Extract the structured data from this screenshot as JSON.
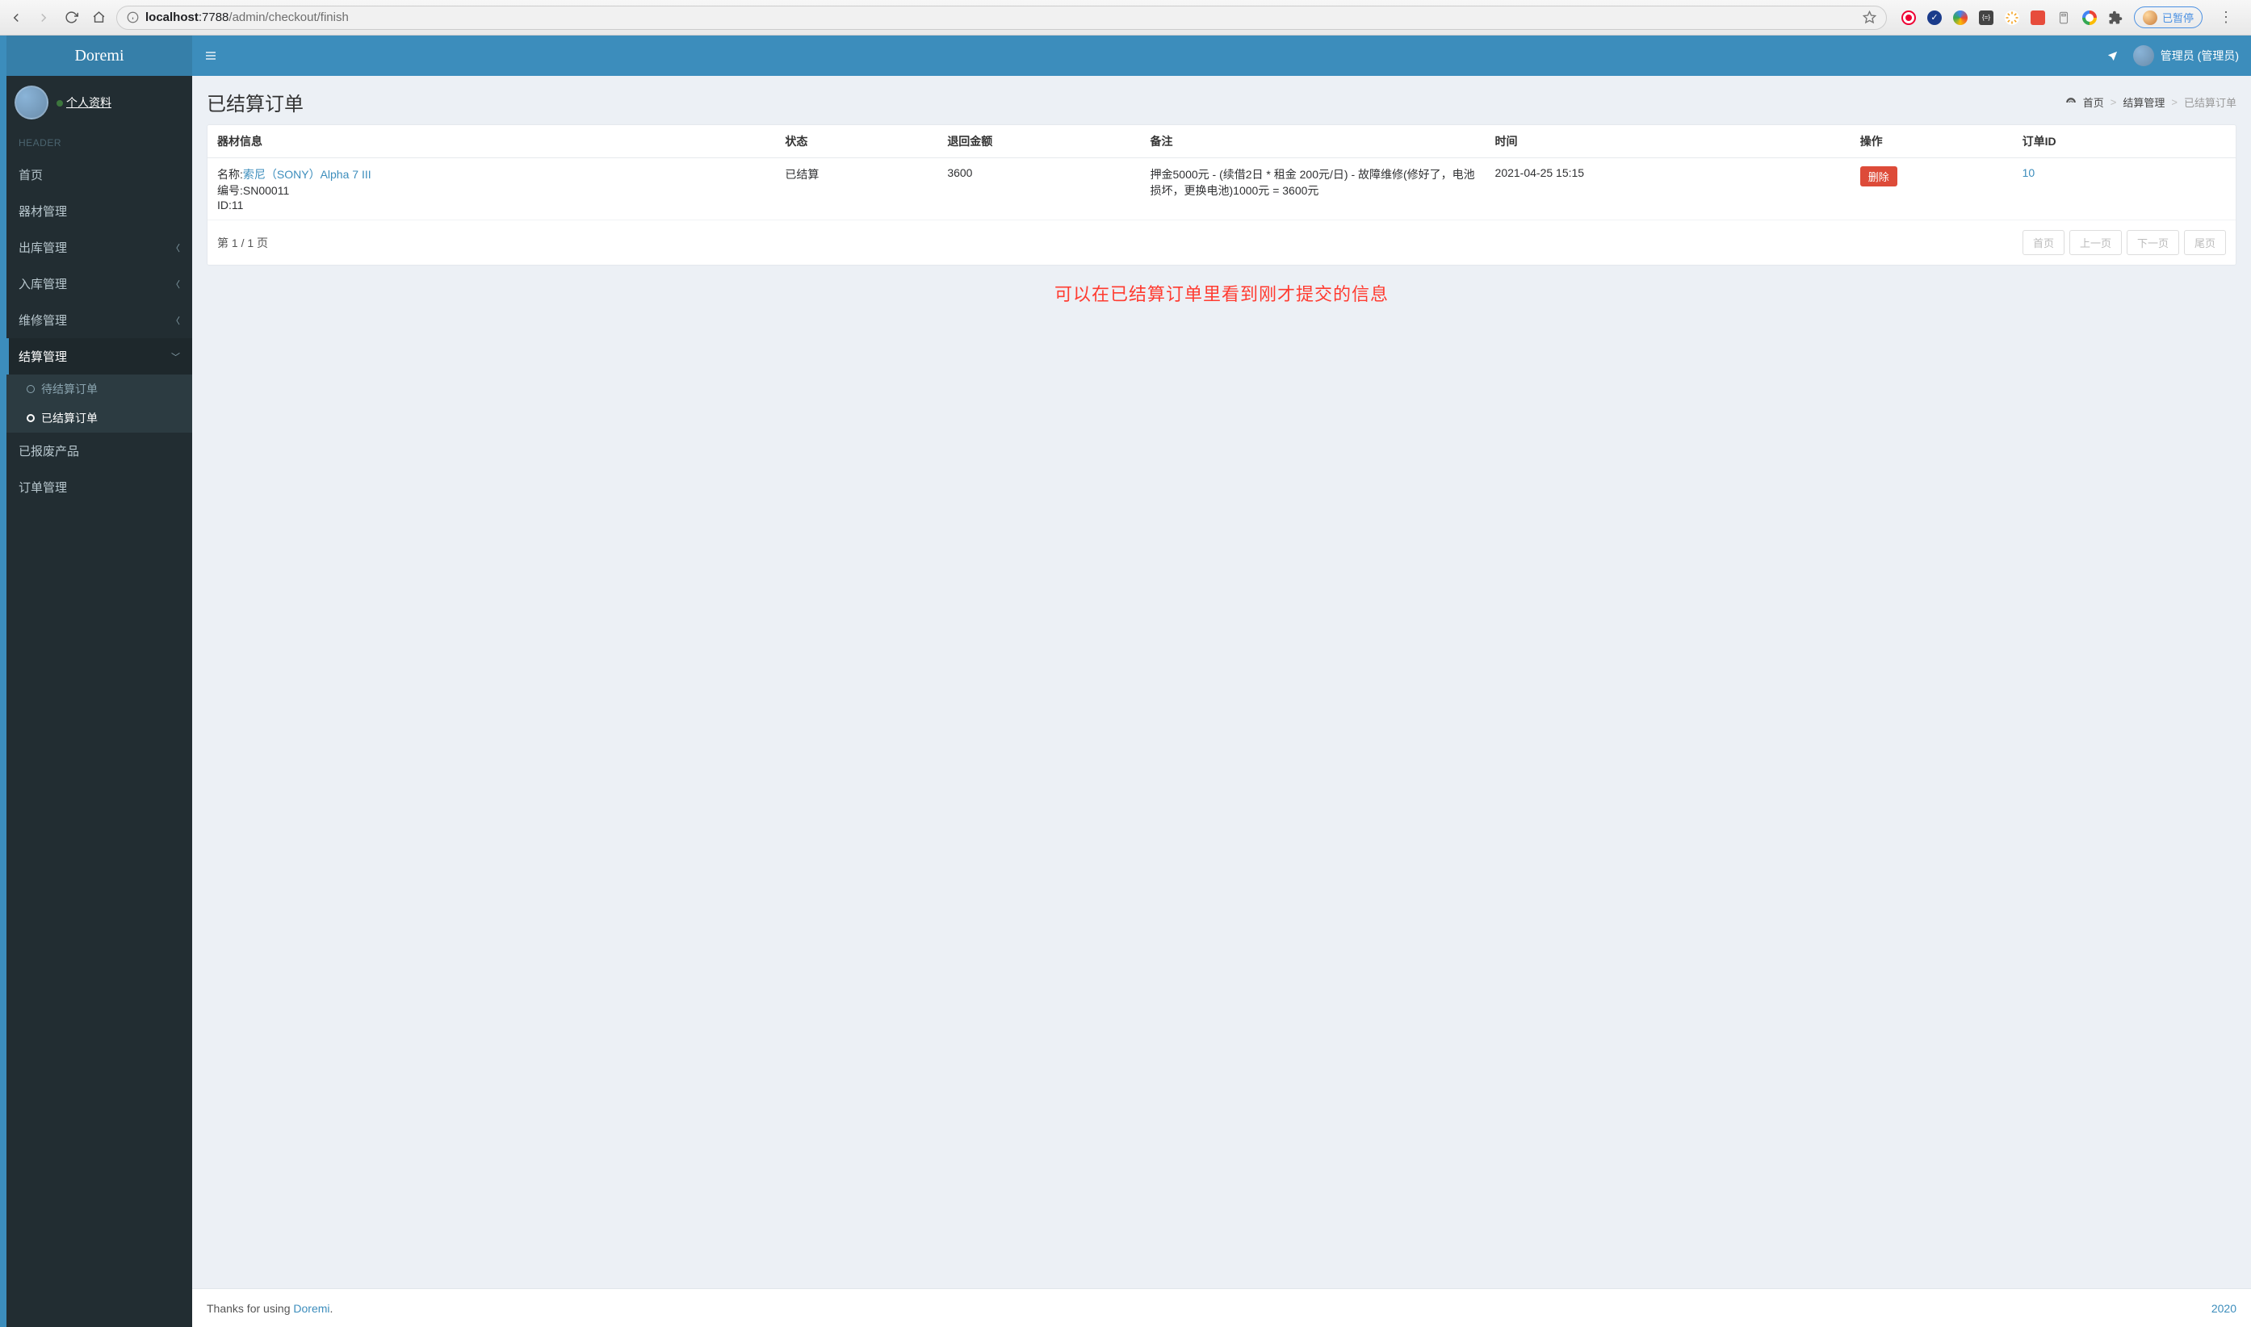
{
  "browser": {
    "url_host": "localhost",
    "url_port": ":7788",
    "url_path": "/admin/checkout/finish",
    "paused_label": "已暂停"
  },
  "brand": "Doremi",
  "user_panel": {
    "profile": "个人资料"
  },
  "sidebar": {
    "header": "HEADER",
    "items": [
      {
        "label": "首页"
      },
      {
        "label": "器材管理"
      },
      {
        "label": "出库管理"
      },
      {
        "label": "入库管理"
      },
      {
        "label": "维修管理"
      },
      {
        "label": "结算管理"
      },
      {
        "label": "已报废产品"
      },
      {
        "label": "订单管理"
      }
    ],
    "settlement_sub": [
      {
        "label": "待结算订单"
      },
      {
        "label": "已结算订单"
      }
    ]
  },
  "topbar": {
    "user_label": "管理员 (管理员)"
  },
  "page": {
    "title": "已结算订单",
    "breadcrumb": {
      "home": "首页",
      "parent": "结算管理",
      "current": "已结算订单"
    }
  },
  "table": {
    "headers": {
      "equipment": "器材信息",
      "status": "状态",
      "refund": "退回金额",
      "remark": "备注",
      "time": "时间",
      "action": "操作",
      "order_id": "订单ID"
    },
    "rows": [
      {
        "name_prefix": "名称:",
        "name_link": "索尼（SONY）Alpha 7 III",
        "serial": "编号:SN00011",
        "id_line": "ID:11",
        "status": "已结算",
        "refund": "3600",
        "remark": "押金5000元 - (续借2日 * 租金 200元/日) - 故障维修(修好了，电池损坏，更换电池)1000元 = 3600元",
        "time": "2021-04-25 15:15",
        "action": "删除",
        "order_id": "10"
      }
    ],
    "page_info": "第 1 / 1 页",
    "pager": {
      "first": "首页",
      "prev": "上一页",
      "next": "下一页",
      "last": "尾页"
    }
  },
  "annotation": "可以在已结算订单里看到刚才提交的信息",
  "footer": {
    "prefix": "Thanks for using ",
    "brand": "Doremi",
    "dot": ".",
    "year": "2020"
  }
}
